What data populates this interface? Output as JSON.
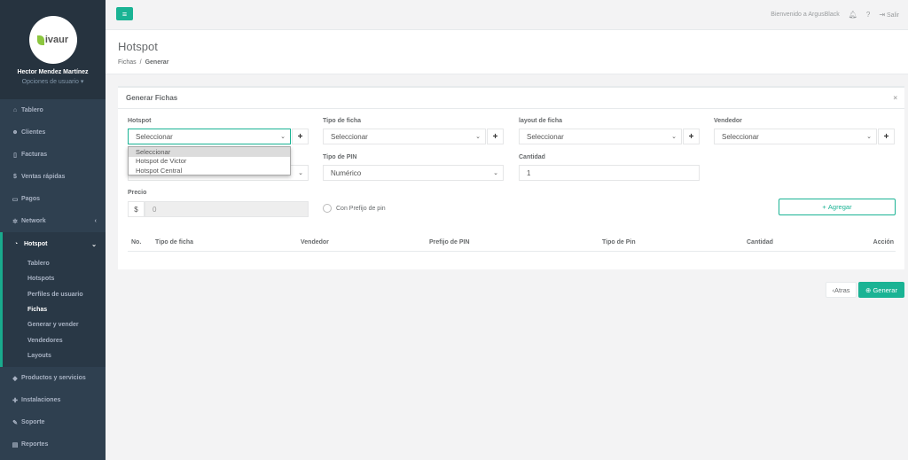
{
  "user": {
    "name": "Hector Mendez Martínez",
    "options_label": "Opciones de usuario"
  },
  "logo_text": "ivaur",
  "sidebar": {
    "items_top": [
      {
        "label": "Tablero",
        "icon": "dashboard-icon"
      },
      {
        "label": "Clientes",
        "icon": "users-icon"
      },
      {
        "label": "Facturas",
        "icon": "file-icon"
      },
      {
        "label": "Ventas rápidas",
        "icon": "dollar-icon"
      },
      {
        "label": "Pagos",
        "icon": "money-icon"
      },
      {
        "label": "Network",
        "icon": "sitemap-icon"
      }
    ],
    "active": {
      "label": "Hotspot",
      "icon": "wifi-icon"
    },
    "sub_items": [
      "Tablero",
      "Hotspots",
      "Perfiles de usuario",
      "Fichas",
      "Generar y vender",
      "Vendedores",
      "Layouts"
    ],
    "active_sub": "Fichas",
    "items_bottom": [
      {
        "label": "Productos y servicios",
        "icon": "tag-icon"
      },
      {
        "label": "Instalaciones",
        "icon": "plug-icon"
      },
      {
        "label": "Soporte",
        "icon": "wrench-icon"
      },
      {
        "label": "Reportes",
        "icon": "book-icon"
      }
    ]
  },
  "topbar": {
    "welcome": "Bienvenido a ArgusBlack",
    "logout": "Salir"
  },
  "page": {
    "title": "Hotspot",
    "breadcrumb": [
      "Fichas",
      "Generar"
    ]
  },
  "panel": {
    "title": "Generar Fichas"
  },
  "form": {
    "hotspot": {
      "label": "Hotspot",
      "value": "Seleccionar",
      "options": [
        "Seleccionar",
        "Hotspot de Victor",
        "Hotspot Central"
      ]
    },
    "tipo_ficha": {
      "label": "Tipo de ficha",
      "value": "Seleccionar"
    },
    "layout_ficha": {
      "label": "layout de ficha",
      "value": "Seleccionar"
    },
    "vendedor": {
      "label": "Vendedor",
      "value": "Seleccionar"
    },
    "tipo_pin": {
      "label": "Tipo de PIN",
      "value": "Numérico"
    },
    "cantidad": {
      "label": "Cantidad",
      "value": "1"
    },
    "precio": {
      "label": "Precio",
      "prefix": "$",
      "value": "0"
    },
    "prefijo": {
      "label": "Con Prefijo de pin"
    },
    "agregar": "Agregar"
  },
  "table": {
    "headers": [
      "No.",
      "Tipo de ficha",
      "Vendedor",
      "Prefijo de PIN",
      "Tipo de Pin",
      "Cantidad",
      "Acción"
    ]
  },
  "actions": {
    "back": "Atras",
    "generate": "Generar"
  },
  "colors": {
    "accent": "#1ab394",
    "sidebar": "#2f4050"
  }
}
